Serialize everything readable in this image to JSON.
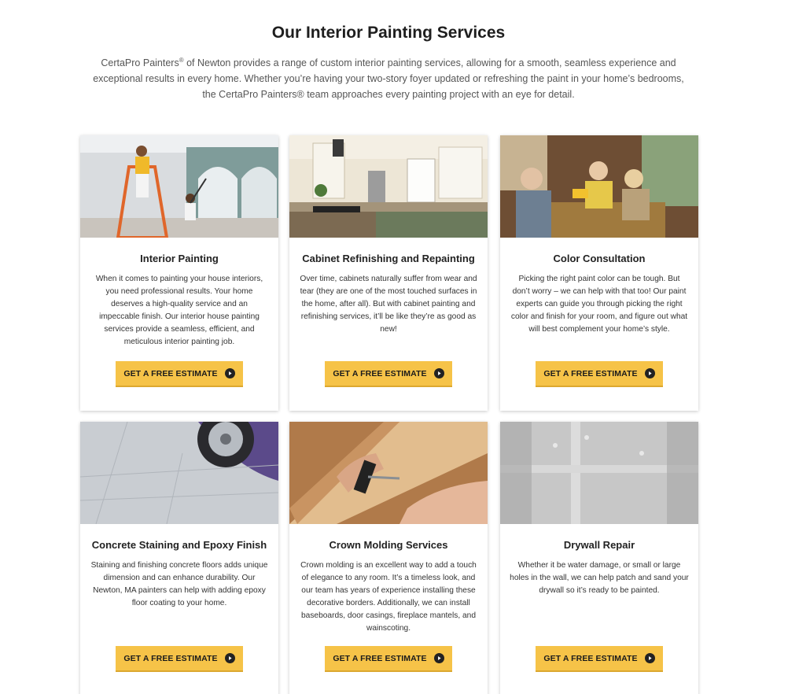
{
  "section": {
    "title": "Our Interior Painting Services",
    "intro_before": "CertaPro Painters",
    "intro_sup": "®",
    "intro_line1_after": " of Newton provides a range of custom interior painting services, allowing for a smooth, seamless experience and",
    "intro_line2": "exceptional results in every home. Whether you’re having your two-story foyer updated or refreshing the paint in your home’s bedrooms,",
    "intro_line3": "the CertaPro Painters® team approaches every painting project with an eye for detail."
  },
  "cards": [
    {
      "title": "Interior Painting",
      "text": "When it comes to painting your house interiors, you need professional results. Your home deserves a high-quality service and an impeccable finish. Our interior house painting services provide a seamless, efficient, and meticulous interior painting job.",
      "button": "GET A FREE ESTIMATE"
    },
    {
      "title": "Cabinet Refinishing and Repainting",
      "text": "Over time, cabinets naturally suffer from wear and tear (they are one of the most touched surfaces in the home, after all). But with cabinet painting and refinishing services, it’ll be like they’re as good as new!",
      "button": "GET A FREE ESTIMATE"
    },
    {
      "title": "Color Consultation",
      "text": "Picking the right paint color can be tough. But don’t worry – we can help with that too! Our paint experts can guide you through picking the right color and finish for your room, and figure out what will best complement your home’s style.",
      "button": "GET A FREE ESTIMATE"
    },
    {
      "title": "Concrete Staining and Epoxy Finish",
      "text": "Staining and finishing concrete floors adds unique dimension and can enhance durability. Our Newton, MA painters can help with adding epoxy floor coating to your home.",
      "button": "GET A FREE ESTIMATE"
    },
    {
      "title": "Crown Molding Services",
      "text": "Crown molding is an excellent way to add a touch of elegance to any room. It’s a timeless look, and our team has years of experience installing these decorative borders. Additionally, we can install baseboards, door casings, fireplace mantels, and wainscoting.",
      "button": "GET A FREE ESTIMATE"
    },
    {
      "title": "Drywall Repair",
      "text": "Whether it be water damage, or small or large holes in the wall, we can help patch and sand your drywall so it’s ready to be painted.",
      "button": "GET A FREE ESTIMATE"
    }
  ],
  "colors": {
    "button_bg": "#f6c348",
    "button_icon": "#222222"
  },
  "icons": {
    "button": "arrow-right-circle-icon"
  }
}
